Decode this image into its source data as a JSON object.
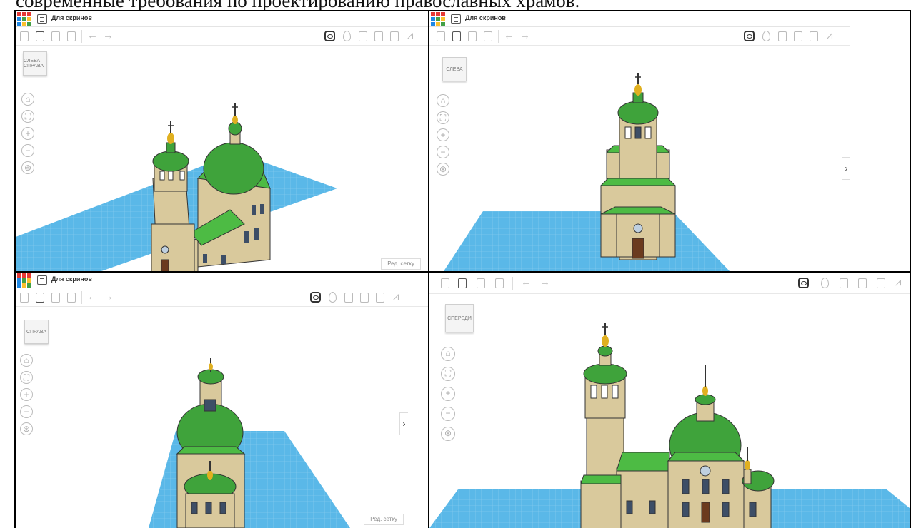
{
  "heading": "современные требования по проектированию православных храмов.",
  "logo_letters": [
    "T",
    "I",
    "N",
    "K",
    "E",
    "R",
    "C",
    "A",
    "D"
  ],
  "logo_colors": [
    "#e53935",
    "#e53935",
    "#e53935",
    "#1e88e5",
    "#43a047",
    "#fbc02d",
    "#1e88e5",
    "#fbc02d",
    "#43a047"
  ],
  "panels": [
    {
      "title": "Для скринов",
      "view_label": "СЛЕВА СПРАВА",
      "grid_button": "Ред. сетку"
    },
    {
      "title": "Для скринов",
      "view_label": "СЛЕВА",
      "side_arrow": "›"
    },
    {
      "title": "Для скринов",
      "view_label": "СПРАВА",
      "side_arrow": "›",
      "grid_button": "Ред. сетку"
    },
    {
      "view_label": "СПЕРЕДИ"
    }
  ],
  "toolbar_icons": [
    "copy-icon",
    "paste-icon",
    "duplicate-icon",
    "delete-icon",
    "undo-icon",
    "redo-icon",
    "view-icon",
    "light-icon",
    "shape-icon",
    "group-icon",
    "align-icon",
    "mirror-icon"
  ],
  "nav_icons": [
    "home-icon",
    "fit-icon",
    "zoom-in-icon",
    "zoom-out-icon",
    "orthographic-icon"
  ],
  "colors": {
    "dome_green": "#3fa33b",
    "roof_green": "#4dbb44",
    "wall": "#d9c99c",
    "grid_blue": "#4aaee0",
    "gold": "#e0b020"
  }
}
